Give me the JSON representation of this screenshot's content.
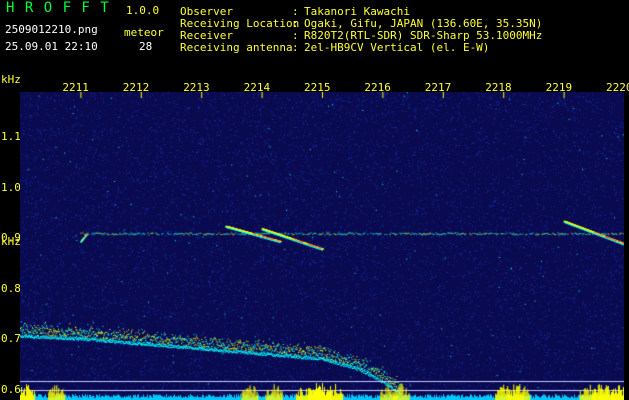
{
  "header": {
    "app_name": "H R O F F T",
    "version": "1.0.0",
    "filename": "2509012210.png",
    "datetime": "25.09.01 22:10",
    "count_label": "meteor",
    "count_value": "28",
    "fields": [
      {
        "label": "Observer",
        "value": "Takanori Kawachi"
      },
      {
        "label": "Receiving Location",
        "value": "Ogaki, Gifu, JAPAN (136.60E, 35.35N)"
      },
      {
        "label": "Receiver",
        "value": "R820T2(RTL-SDR) SDR-Sharp 53.1000MHz"
      },
      {
        "label": "Receiving antenna",
        "value": "2el-HB9CV Vertical (el. E-W)"
      }
    ],
    "separator": ":"
  },
  "chart_data": {
    "type": "heatmap",
    "x_unit": "time (HHMM)",
    "x_ticks": [
      "2211",
      "2212",
      "2213",
      "2214",
      "2215",
      "2216",
      "2217",
      "2218",
      "2219",
      "2220"
    ],
    "y_unit": "kHz",
    "y_ticks": [
      "1.1",
      "1.0",
      "0.9",
      "0.8",
      "0.7",
      "0.6"
    ],
    "ylim": [
      0.58,
      1.19
    ],
    "xlim": [
      0,
      10
    ],
    "colors": {
      "background": "#0a0a50",
      "noise": "#1c3cc8",
      "signal": "#00ffff",
      "strong": "#ffff00",
      "hot": "#ff3030",
      "baseline": "#00c8ff",
      "grid_line": "#c8c8ff"
    },
    "carrier_line_khz": 0.91,
    "reference_lines_khz": [
      0.617,
      0.6
    ],
    "traces": [
      {
        "type": "drifting-carrier",
        "points": [
          [
            0.0,
            0.71
          ],
          [
            1.0,
            0.705
          ],
          [
            2.0,
            0.695
          ],
          [
            3.0,
            0.685
          ],
          [
            4.0,
            0.675
          ],
          [
            5.0,
            0.665
          ],
          [
            5.6,
            0.645
          ],
          [
            6.0,
            0.62
          ],
          [
            6.3,
            0.595
          ]
        ]
      },
      {
        "type": "meteor-head",
        "points": [
          [
            3.4,
            0.925
          ],
          [
            4.3,
            0.895
          ]
        ]
      },
      {
        "type": "meteor-head",
        "points": [
          [
            4.0,
            0.92
          ],
          [
            5.0,
            0.88
          ]
        ]
      },
      {
        "type": "meteor-head",
        "points": [
          [
            9.0,
            0.935
          ],
          [
            10.0,
            0.89
          ]
        ]
      },
      {
        "type": "meteor-echo",
        "points": [
          [
            1.0,
            0.895
          ],
          [
            1.1,
            0.91
          ]
        ]
      }
    ],
    "bottom_burst_x": [
      0.1,
      0.6,
      3.8,
      4.2,
      4.7,
      4.9,
      5.0,
      5.2,
      6.1,
      6.3,
      8.0,
      8.2,
      8.3,
      9.4,
      9.6,
      9.7,
      9.9
    ]
  }
}
